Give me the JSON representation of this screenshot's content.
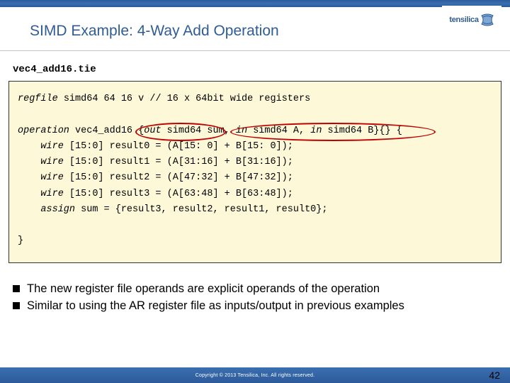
{
  "header": {
    "title": "SIMD Example: 4-Way Add Operation",
    "logo_text": "tensilica"
  },
  "filename": "vec4_add16.tie",
  "code": {
    "line1_kw": "regfile",
    "line1_rest": " simd64 64 16 v",
    "line1_comment": "// 16 x 64bit wide registers",
    "op_kw": "operation",
    "op_name": " vec4_add16 {",
    "out_kw": "out",
    "out_rest": " simd64 sum, ",
    "in1_kw": "in",
    "in1_rest": " simd64 A, ",
    "in2_kw": "in",
    "in2_rest": " simd64 B}{} {",
    "w0a": "wire",
    "w0b": " [15:0] result0 = (A[15: 0] + B[15: 0]);",
    "w1a": "wire",
    "w1b": " [15:0] result1 = (A[31:16] + B[31:16]);",
    "w2a": "wire",
    "w2b": " [15:0] result2 = (A[47:32] + B[47:32]);",
    "w3a": "wire",
    "w3b": " [15:0] result3 = (A[63:48] + B[63:48]);",
    "asg_a": "assign",
    "asg_b": " sum = {result3, result2, result1, result0};",
    "close": "}"
  },
  "bullets": {
    "b1": "The new register file operands are explicit operands of the operation",
    "b2": "Similar to using the AR register file as inputs/output in previous examples"
  },
  "footer": {
    "copyright": "Copyright © 2013  Tensilica, Inc. All rights reserved.",
    "page": "42"
  }
}
